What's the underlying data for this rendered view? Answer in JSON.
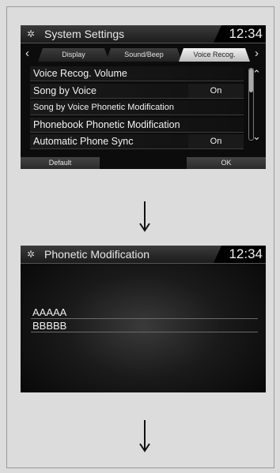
{
  "screen1": {
    "title": "System Settings",
    "clock": "12:34",
    "tabs": [
      "Display",
      "Sound/Beep",
      "Voice Recog."
    ],
    "rows": [
      {
        "label": "Voice Recog. Volume",
        "value": ""
      },
      {
        "label": "Song by Voice",
        "value": "On"
      },
      {
        "label": "Song by Voice Phonetic Modification",
        "value": ""
      },
      {
        "label": "Phonebook Phonetic Modification",
        "value": ""
      },
      {
        "label": "Automatic Phone Sync",
        "value": "On"
      }
    ],
    "footer": {
      "default": "Default",
      "ok": "OK"
    }
  },
  "screen2": {
    "title": "Phonetic Modification",
    "clock": "12:34",
    "entries": [
      "AAAAA",
      "BBBBB"
    ]
  },
  "icons": {
    "gear": "gear-icon",
    "left": "chevron-left-icon",
    "right": "chevron-right-icon",
    "up": "double-chevron-up-icon",
    "down": "double-chevron-down-icon",
    "flow": "down-arrow-icon"
  }
}
